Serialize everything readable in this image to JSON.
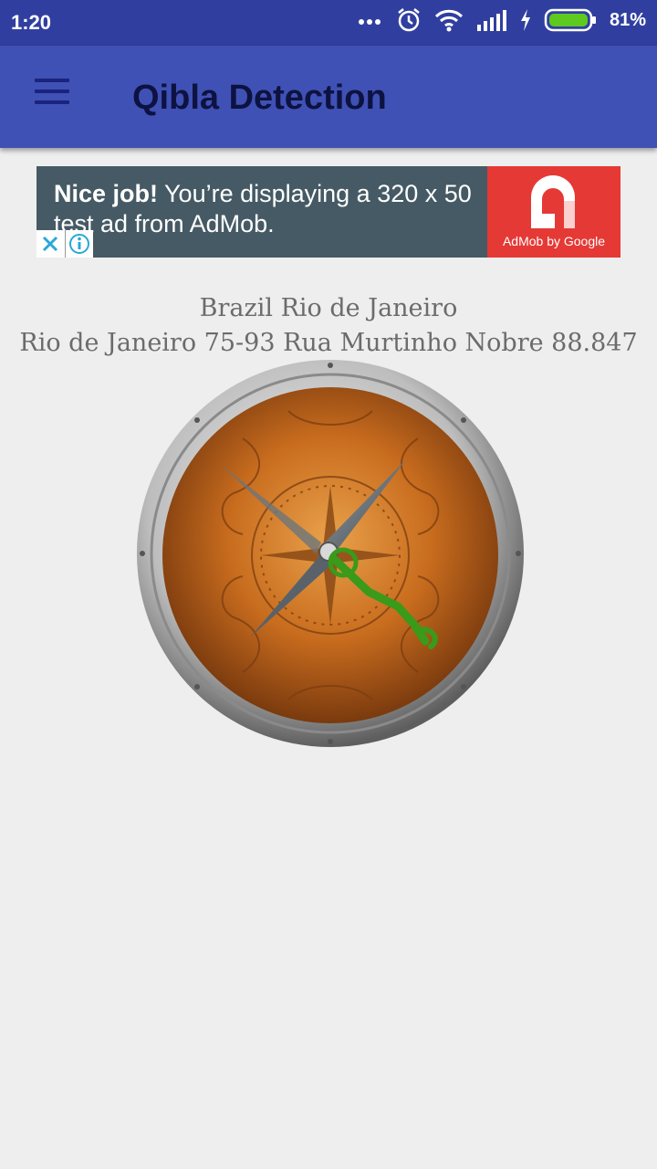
{
  "status_bar": {
    "time": "1:20",
    "battery_percent": "81%",
    "icons": [
      "more-dots-icon",
      "alarm-icon",
      "wifi-icon",
      "signal-icon",
      "charging-icon",
      "battery-icon"
    ]
  },
  "app_bar": {
    "title": "Qibla Detection",
    "menu_icon": "hamburger-menu-icon",
    "color": "#3f51b5"
  },
  "ad": {
    "headline": "Nice job!",
    "body": " You’re displaying a 320 x 50 test ad from AdMob.",
    "logo_caption": "AdMob by Google",
    "close_icon": "close-icon",
    "info_icon": "info-icon"
  },
  "location": {
    "line1": "Brazil Rio de Janeiro",
    "line2": "Rio de Janeiro 75-93 Rua Murtinho Nobre  88.847"
  },
  "compass": {
    "qibla_arrow_color": "#3a9a1a"
  }
}
